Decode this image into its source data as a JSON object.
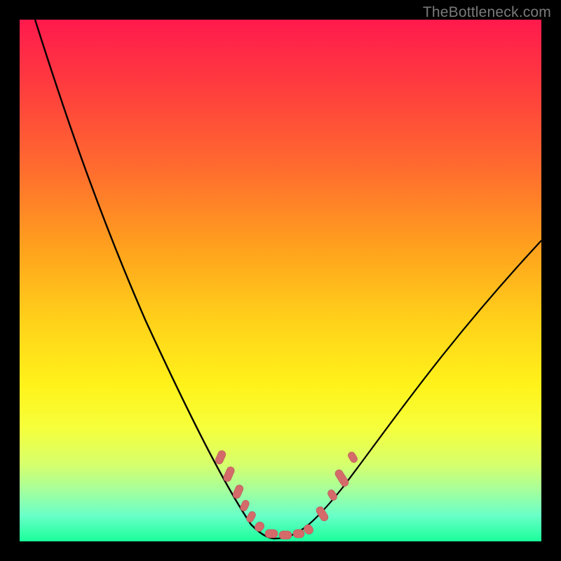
{
  "watermark": "TheBottleneck.com",
  "colors": {
    "frame": "#000000",
    "curve": "#000000",
    "marker_fill": "#d46a6a",
    "marker_stroke": "#b85a5a",
    "gradient_top": "#ff1a4d",
    "gradient_bottom": "#1aff9a"
  },
  "chart_data": {
    "type": "line",
    "title": "",
    "xlabel": "",
    "ylabel": "",
    "xlim": [
      0,
      100
    ],
    "ylim": [
      0,
      100
    ],
    "note": "Axes are unlabeled; values estimated from pixel positions on a 0–100 normalized scale (y=0 at bottom, y=100 at top). Curve is a V-shape with minimum near x≈48.",
    "series": [
      {
        "name": "curve-left",
        "x": [
          3,
          10,
          20,
          30,
          38,
          44,
          48
        ],
        "values": [
          100,
          80,
          54,
          30,
          14,
          4,
          1
        ]
      },
      {
        "name": "curve-right",
        "x": [
          48,
          55,
          62,
          70,
          80,
          90,
          100
        ],
        "values": [
          1,
          3,
          8,
          18,
          34,
          48,
          58
        ]
      }
    ],
    "markers": {
      "name": "highlight-beads",
      "x": [
        38,
        40,
        42,
        43,
        44,
        46,
        48,
        50,
        52,
        54,
        58,
        60,
        62,
        63
      ],
      "values": [
        16,
        13,
        10,
        8,
        6,
        3,
        2,
        2,
        2,
        3,
        7,
        10,
        14,
        18
      ]
    }
  }
}
